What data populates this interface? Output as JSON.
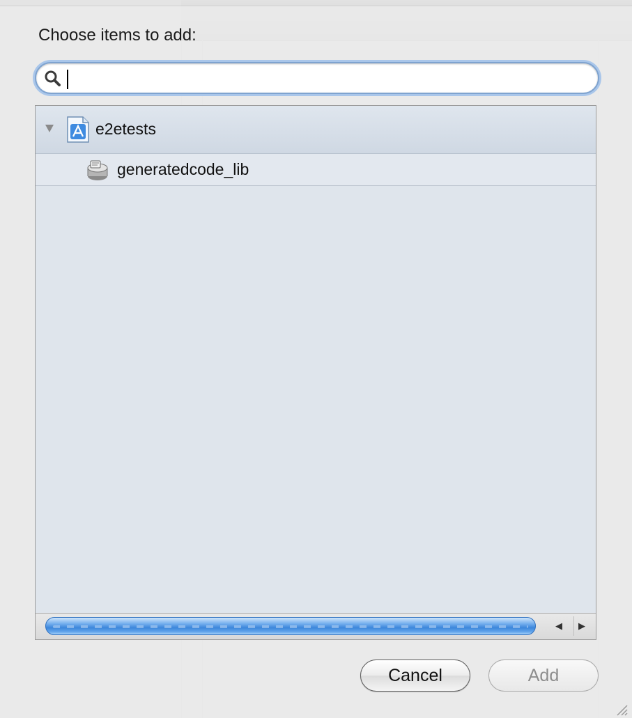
{
  "dialog": {
    "heading": "Choose items to add:",
    "search": {
      "value": "",
      "placeholder": ""
    },
    "tree": {
      "group_label": "e2etests",
      "group_expanded": true,
      "items": [
        {
          "label": "generatedcode_lib",
          "icon": "static-library-icon"
        }
      ]
    },
    "buttons": {
      "cancel": "Cancel",
      "add": "Add",
      "add_enabled": false
    }
  },
  "icons": {
    "search": "search-icon",
    "project": "xcode-project-icon",
    "library": "static-library-icon",
    "disclosure": "disclosure-triangle-icon"
  },
  "colors": {
    "focus_ring": "#a9c6ea",
    "list_background": "#dfe5ec",
    "scroll_thumb": "#3c86db"
  }
}
